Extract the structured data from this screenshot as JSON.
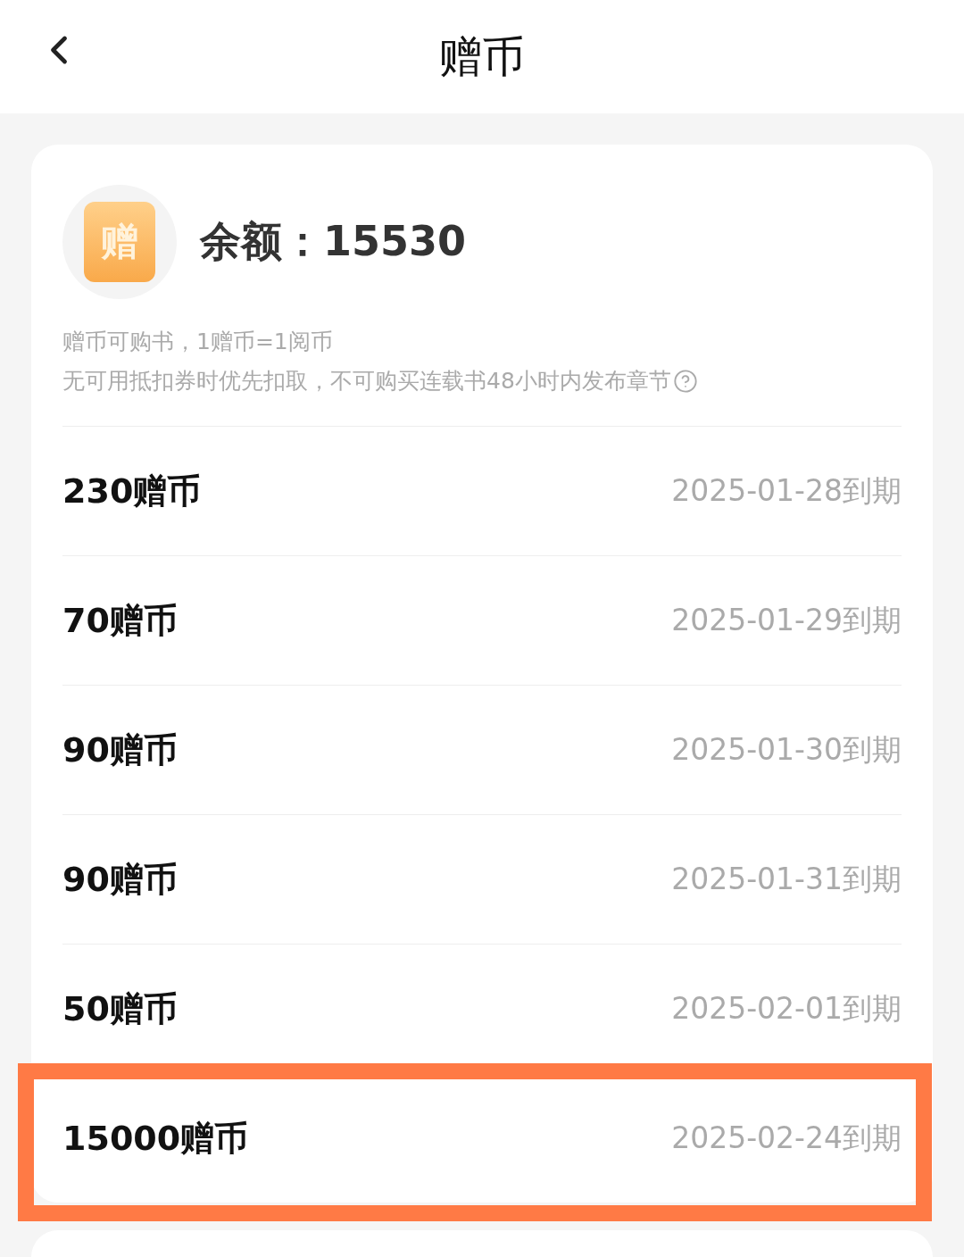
{
  "header": {
    "title": "赠币"
  },
  "balance": {
    "icon_glyph": "赠",
    "label": "余额：",
    "amount": "15530"
  },
  "description": [
    "赠币可购书，1赠币=1阅币",
    "无可用抵扣券时优先扣取，不可购买连载书48小时内发布章节"
  ],
  "coins": [
    {
      "amount": "230赠币",
      "expiry": "2025-01-28到期",
      "highlighted": false
    },
    {
      "amount": "70赠币",
      "expiry": "2025-01-29到期",
      "highlighted": false
    },
    {
      "amount": "90赠币",
      "expiry": "2025-01-30到期",
      "highlighted": false
    },
    {
      "amount": "90赠币",
      "expiry": "2025-01-31到期",
      "highlighted": false
    },
    {
      "amount": "50赠币",
      "expiry": "2025-02-01到期",
      "highlighted": false
    },
    {
      "amount": "15000赠币",
      "expiry": "2025-02-24到期",
      "highlighted": true
    }
  ]
}
